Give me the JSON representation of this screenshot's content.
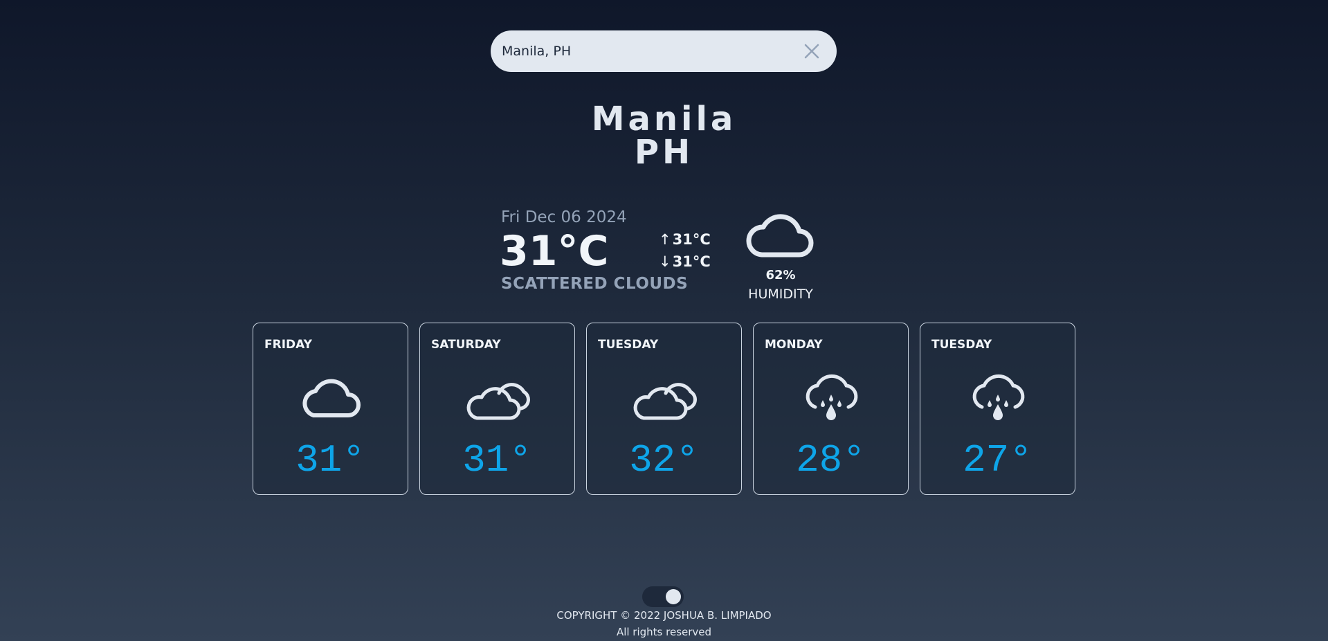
{
  "search": {
    "value": "Manila, PH",
    "clear_icon": "close-icon"
  },
  "location": {
    "city": "Manila",
    "country": "PH"
  },
  "current": {
    "date": "Fri Dec 06 2024",
    "temperature": "31°C",
    "description": "SCATTERED CLOUDS",
    "high": "31°C",
    "low": "31°C",
    "icon": "cloud-icon",
    "humidity_value": "62%",
    "humidity_label": "HUMIDITY"
  },
  "forecast": [
    {
      "day": "FRIDAY",
      "temp": "31°",
      "icon": "cloud-icon"
    },
    {
      "day": "SATURDAY",
      "temp": "31°",
      "icon": "clouds-icon"
    },
    {
      "day": "TUESDAY",
      "temp": "32°",
      "icon": "clouds-icon"
    },
    {
      "day": "MONDAY",
      "temp": "28°",
      "icon": "rain-cloud-icon"
    },
    {
      "day": "TUESDAY",
      "temp": "27°",
      "icon": "rain-cloud-icon"
    }
  ],
  "footer": {
    "theme_toggle": "on",
    "copyright": "COPYRIGHT © 2022 JOSHUA B. LIMPIADO",
    "rights": "All rights reserved"
  },
  "colors": {
    "accent": "#0ea5e9",
    "background_top": "#0f172a",
    "background_bottom": "#334155",
    "text": "#e2e8f0"
  }
}
